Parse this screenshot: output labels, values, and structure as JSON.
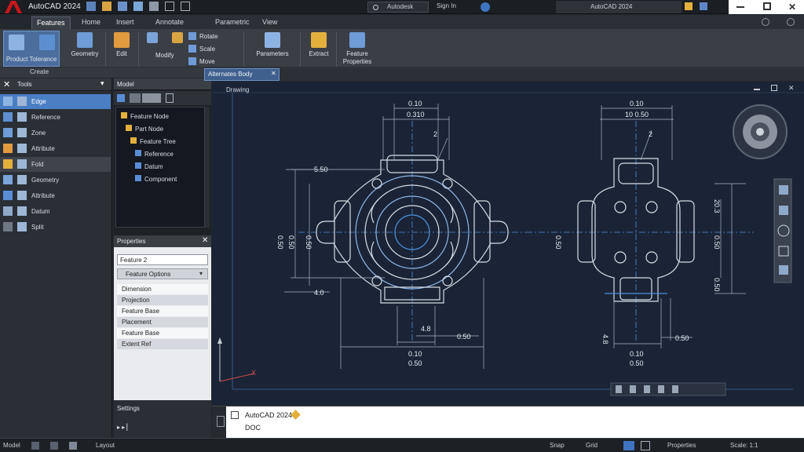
{
  "titlebar": {
    "app_title": "AutoCAD 2024",
    "search_label": "Autodesk",
    "signin_label": "Sign In",
    "workspace_label": "AutoCAD 2024",
    "brand_color": "#c8161d"
  },
  "ribbon": {
    "tabs": [
      "Features",
      "Home",
      "Insert",
      "Annotate",
      "Parametric",
      "View"
    ],
    "active_tab": 0,
    "buttons": {
      "product": "Product",
      "tolerance": "Tolerance",
      "geometry": "Geometry",
      "edit": "Edit",
      "modify": "Modify",
      "rotate": "Rotate",
      "scale": "Scale",
      "move": "Move",
      "parameters": "Parameters",
      "extract": "Extract",
      "feature_properties": "Feature Properties"
    },
    "panel_label": "Create"
  },
  "left_panel": {
    "header": "Tools",
    "items": [
      {
        "label": "Edge",
        "state": "selected"
      },
      {
        "label": "Reference",
        "state": ""
      },
      {
        "label": "Zone",
        "state": ""
      },
      {
        "label": "Attribute",
        "state": ""
      },
      {
        "label": "Fold",
        "state": "highlighted"
      },
      {
        "label": "Geometry",
        "state": ""
      },
      {
        "label": "Attribute",
        "state": ""
      },
      {
        "label": "Datum",
        "state": ""
      },
      {
        "label": "Split",
        "state": ""
      }
    ]
  },
  "model_panel": {
    "header": "Model",
    "tree": [
      "Feature Node",
      "Part Node",
      "Feature Tree",
      "Reference",
      "Datum",
      "Component"
    ]
  },
  "properties_panel": {
    "header": "Properties",
    "field_value": "Feature 2",
    "dropdown_label": "Feature Options",
    "rows": [
      "Dimension",
      "Projection",
      "Feature Base",
      "Placement",
      "Feature Base",
      "Extent Ref"
    ],
    "footer_label": "Settings"
  },
  "document": {
    "tab_label": "Alternates Body",
    "viewport_label": "Drawing"
  },
  "drawing": {
    "left_view": {
      "top_dims": [
        "0.10",
        "0.310"
      ],
      "callout": "2",
      "left_dim_label": "5.50",
      "vert_dims": [
        "0.50",
        "0.50"
      ],
      "side_label": "0.50",
      "bottom_left": "4.0",
      "bottom_dims": [
        "0.10",
        "0.50"
      ],
      "small_dims": [
        "4.8",
        "0.50"
      ]
    },
    "right_view": {
      "top_dims": [
        "0.10",
        "10 0.50"
      ],
      "callout": "2",
      "left_label": "0.50",
      "right_dims": [
        "20.3",
        "0.50",
        "0.50"
      ],
      "bottom_dims": [
        "0.10",
        "0.50"
      ],
      "small_dims": [
        "4.8",
        "0.50"
      ]
    },
    "ucs_label": "X"
  },
  "command_line": {
    "history_line": "AutoCAD 2024",
    "prompt_text": "DOC"
  },
  "status_bar": {
    "model_label": "Model",
    "layout_label": "Layout",
    "snap_label": "Snap",
    "grid_label": "Grid",
    "properties_label": "Properties",
    "zoom_label": "Scale: 1:1"
  }
}
